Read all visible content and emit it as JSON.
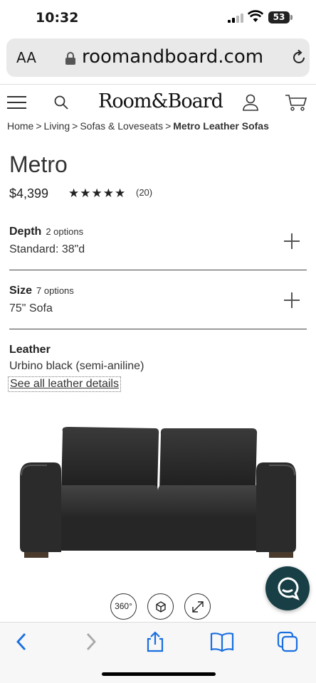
{
  "status_bar": {
    "time": "10:32",
    "battery": "53"
  },
  "browser": {
    "text_size_label": "AA",
    "url": "roomandboard.com"
  },
  "site": {
    "logo": "Room&Board"
  },
  "breadcrumb": [
    {
      "label": "Home"
    },
    {
      "label": "Living"
    },
    {
      "label": "Sofas & Loveseats"
    },
    {
      "label": "Metro Leather Sofas"
    }
  ],
  "breadcrumb_separator": ">",
  "product": {
    "title": "Metro",
    "price": "$4,399",
    "stars": "★★★★★",
    "rating": 5,
    "reviews": "(20)"
  },
  "options": {
    "depth": {
      "label": "Depth",
      "count": "2 options",
      "value": "Standard: 38\"d"
    },
    "size": {
      "label": "Size",
      "count": "7 options",
      "value": "75\" Sofa"
    },
    "leather": {
      "label": "Leather",
      "value": "Urbino black (semi-aniline)",
      "link": "See all leather details"
    }
  },
  "view_buttons": {
    "spin": "360°"
  },
  "colors": {
    "chat_bg": "#173f45",
    "accent_blue": "#1a6fe0",
    "sofa": "#2a2a2a"
  },
  "icons": [
    "signal-icon",
    "wifi-icon",
    "lock-icon",
    "reload-icon",
    "menu-icon",
    "search-icon",
    "user-icon",
    "cart-icon",
    "plus-icon",
    "ar-cube-icon",
    "expand-icon",
    "chat-icon",
    "back-icon",
    "forward-icon",
    "share-icon",
    "bookmarks-icon",
    "tabs-icon"
  ]
}
